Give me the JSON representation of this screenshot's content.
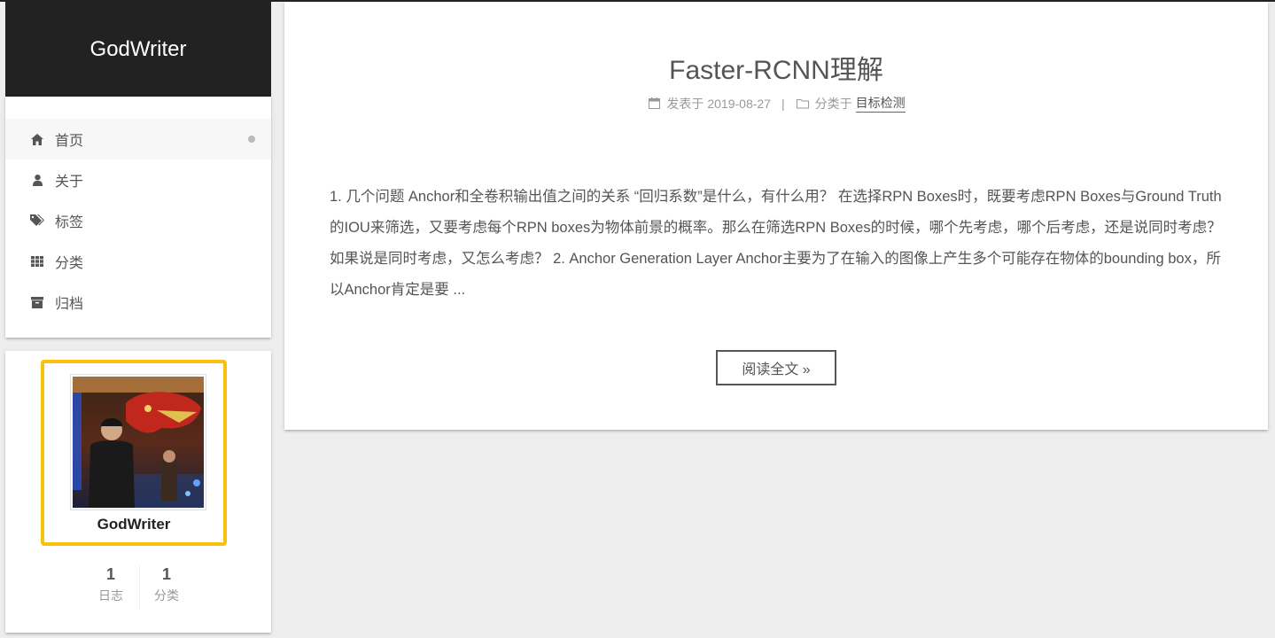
{
  "site": {
    "brand": "GodWriter"
  },
  "menu": {
    "items": [
      {
        "label": "首页",
        "icon": "home-icon",
        "active": true
      },
      {
        "label": "关于",
        "icon": "user-icon"
      },
      {
        "label": "标签",
        "icon": "tags-icon"
      },
      {
        "label": "分类",
        "icon": "grid-icon"
      },
      {
        "label": "归档",
        "icon": "archive-icon"
      }
    ]
  },
  "author": {
    "name": "GodWriter",
    "stats": [
      {
        "count": "1",
        "label": "日志"
      },
      {
        "count": "1",
        "label": "分类"
      }
    ],
    "frame_color": "#f9c10b"
  },
  "post": {
    "title": "Faster-RCNN理解",
    "posted_label": "发表于",
    "date": "2019-08-27",
    "separator": "|",
    "category_label": "分类于",
    "category": "目标检测",
    "excerpt": "1. 几个问题 Anchor和全卷积输出值之间的关系 “回归系数”是什么，有什么用？ 在选择RPN Boxes时，既要考虑RPN Boxes与Ground Truth的IOU来筛选，又要考虑每个RPN boxes为物体前景的概率。那么在筛选RPN Boxes的时候，哪个先考虑，哪个后考虑，还是说同时考虑？ 如果说是同时考虑，又怎么考虑？ 2. Anchor Generation Layer Anchor主要为了在输入的图像上产生多个可能存在物体的bounding box，所以Anchor肯定是要 ...",
    "read_more": "阅读全文 »"
  }
}
